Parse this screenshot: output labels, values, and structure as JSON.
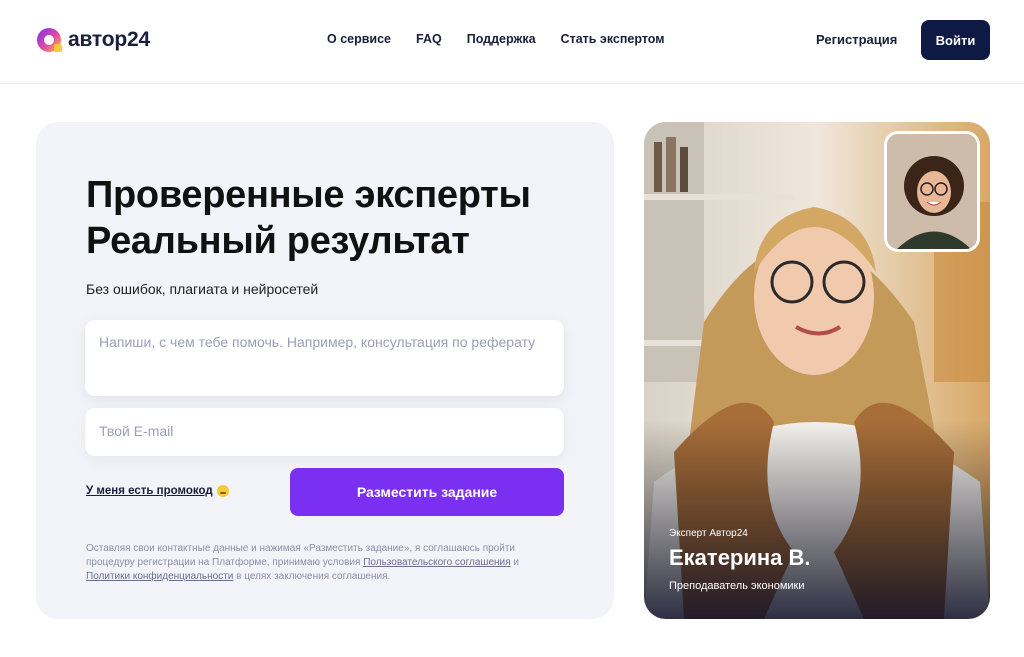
{
  "header": {
    "logo_text": "автор24",
    "nav": [
      "О сервисе",
      "FAQ",
      "Поддержка",
      "Стать экспертом"
    ],
    "register_label": "Регистрация",
    "login_label": "Войти"
  },
  "hero": {
    "title_line1": "Проверенные эксперты",
    "title_line2": "Реальный результат",
    "subtitle": "Без ошибок, плагиата и нейросетей",
    "task_placeholder": "Напиши, с чем тебе помочь. Например, консультация по реферату",
    "email_placeholder": "Твой E-mail",
    "promo_label": "У меня есть промокод",
    "submit_label": "Разместить задание",
    "legal_text1": "Оставляя свои контактные данные и нажимая «Разместить задание», я соглашаюсь пройти процедуру регистрации на Платформе, принимаю условия ",
    "legal_link1": "Пользовательского соглашения",
    "legal_and": " и ",
    "legal_link2": "Политики конфиденциальности",
    "legal_text2": " в целях заключения соглашения."
  },
  "expert": {
    "label": "Эксперт Автор24",
    "name": "Екатерина В.",
    "role": "Преподаватель экономики"
  },
  "colors": {
    "brand_dark": "#0f1a44",
    "accent_purple": "#7b2ff0",
    "card_bg": "#f3f4f9"
  }
}
